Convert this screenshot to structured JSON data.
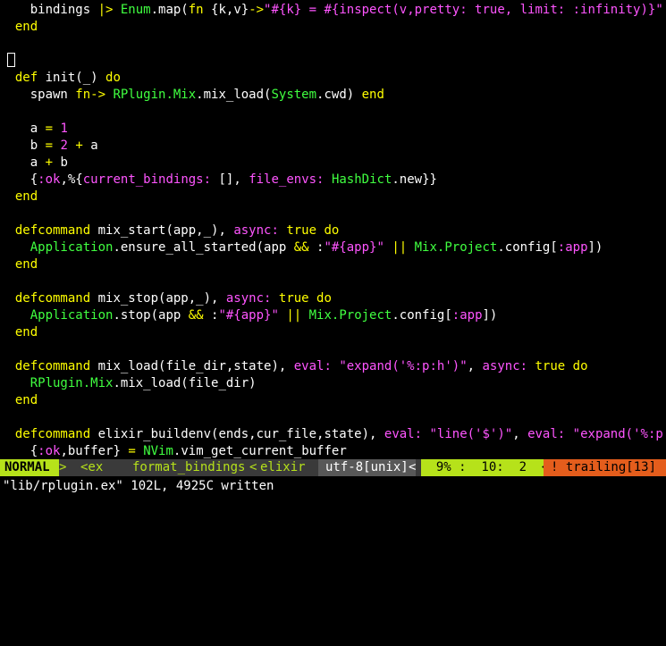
{
  "editor": {
    "cursor_line": 3,
    "lines": [
      "    bindings |> Enum.map(fn {k,v}->\"#{k} = #{inspect(v,pretty: true, limit: :infinity)}\" end",
      "  end",
      "",
      "",
      "  def init(_) do",
      "    spawn fn-> RPlugin.Mix.mix_load(System.cwd) end",
      "",
      "    a = 1",
      "    b = 2 + a",
      "    a + b",
      "    {:ok,%{current_bindings: [], file_envs: HashDict.new}}",
      "  end",
      "",
      "  defcommand mix_start(app,_), async: true do",
      "    Application.ensure_all_started(app && :\"#{app}\" || Mix.Project.config[:app])",
      "  end",
      "",
      "  defcommand mix_stop(app,_), async: true do",
      "    Application.stop(app && :\"#{app}\" || Mix.Project.config[:app])",
      "  end",
      "",
      "  defcommand mix_load(file_dir,state), eval: \"expand('%:p:h')\", async: true do",
      "    RPlugin.Mix.mix_load(file_dir)",
      "  end",
      "",
      "  defcommand elixir_buildenv(ends,cur_file,state), eval: \"line('$')\", eval: \"expand('%:p:h')",
      "    {:ok,buffer} = NVim.vim_get_current_buffer"
    ]
  },
  "statusline": {
    "mode": "NORMAL",
    "mode_separator": ">",
    "branch": "<ex",
    "function": "format_bindings",
    "filetype_separator": "<",
    "filetype": "elixir",
    "encoding": "utf-8[unix]",
    "encoding_separator": "<",
    "position": "  9% :  10:  2  <",
    "warning": "! trailing[13]"
  },
  "cmdline": {
    "message": "\"lib/rplugin.ex\" 102L, 4925C written"
  },
  "colors": {
    "keyword": "#ffff00",
    "module": "#40ff40",
    "string": "#ff55ff",
    "mode_bg": "#b6e21a",
    "warning_bg": "#e45d1c"
  }
}
